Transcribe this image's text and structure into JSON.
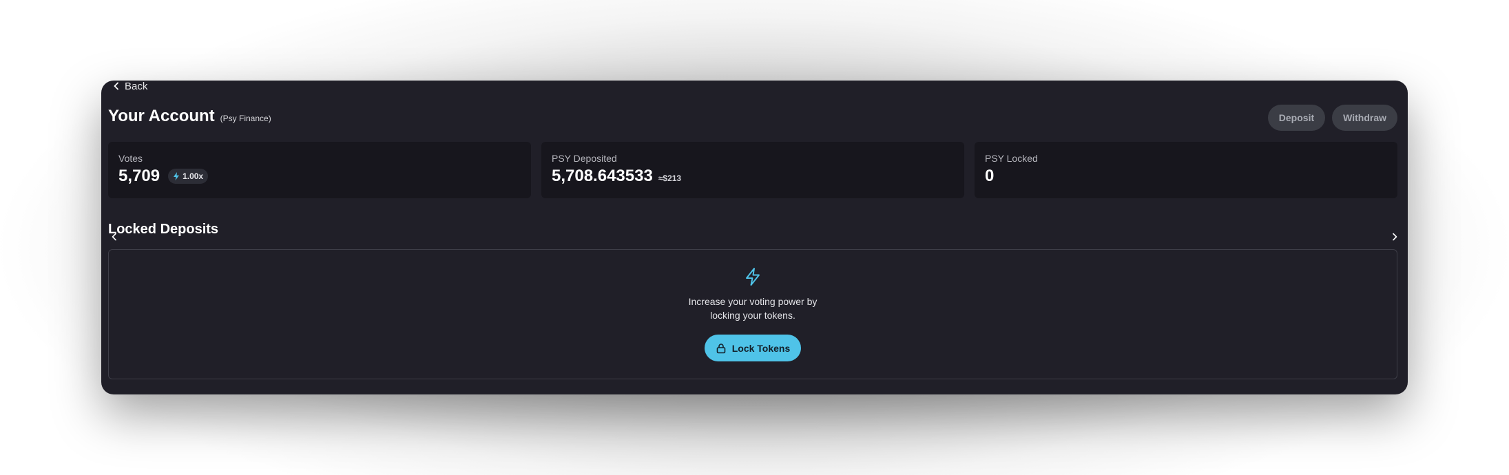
{
  "nav": {
    "back_label": "Back"
  },
  "header": {
    "title": "Your Account",
    "subtitle": "(Psy Finance)",
    "deposit_label": "Deposit",
    "withdraw_label": "Withdraw"
  },
  "stats": {
    "votes": {
      "label": "Votes",
      "value": "5,709",
      "multiplier": "1.00x"
    },
    "deposited": {
      "label": "PSY Deposited",
      "value": "5,708.643533",
      "usd": "≈$213"
    },
    "locked": {
      "label": "PSY Locked",
      "value": "0"
    }
  },
  "locked_deposits": {
    "title": "Locked Deposits",
    "empty_text": "Increase your voting power by locking your tokens.",
    "lock_button_label": "Lock Tokens"
  },
  "icons": {
    "back": "chevron-left-icon",
    "multiplier": "lightning-icon",
    "empty_state": "lightning-icon",
    "lock": "lock-icon",
    "prev": "chevron-left-icon",
    "next": "chevron-right-icon"
  },
  "colors": {
    "panel": "#201f28",
    "card": "#17161d",
    "accent": "#4fc3e8",
    "ghost_button": "#3b3d45"
  }
}
